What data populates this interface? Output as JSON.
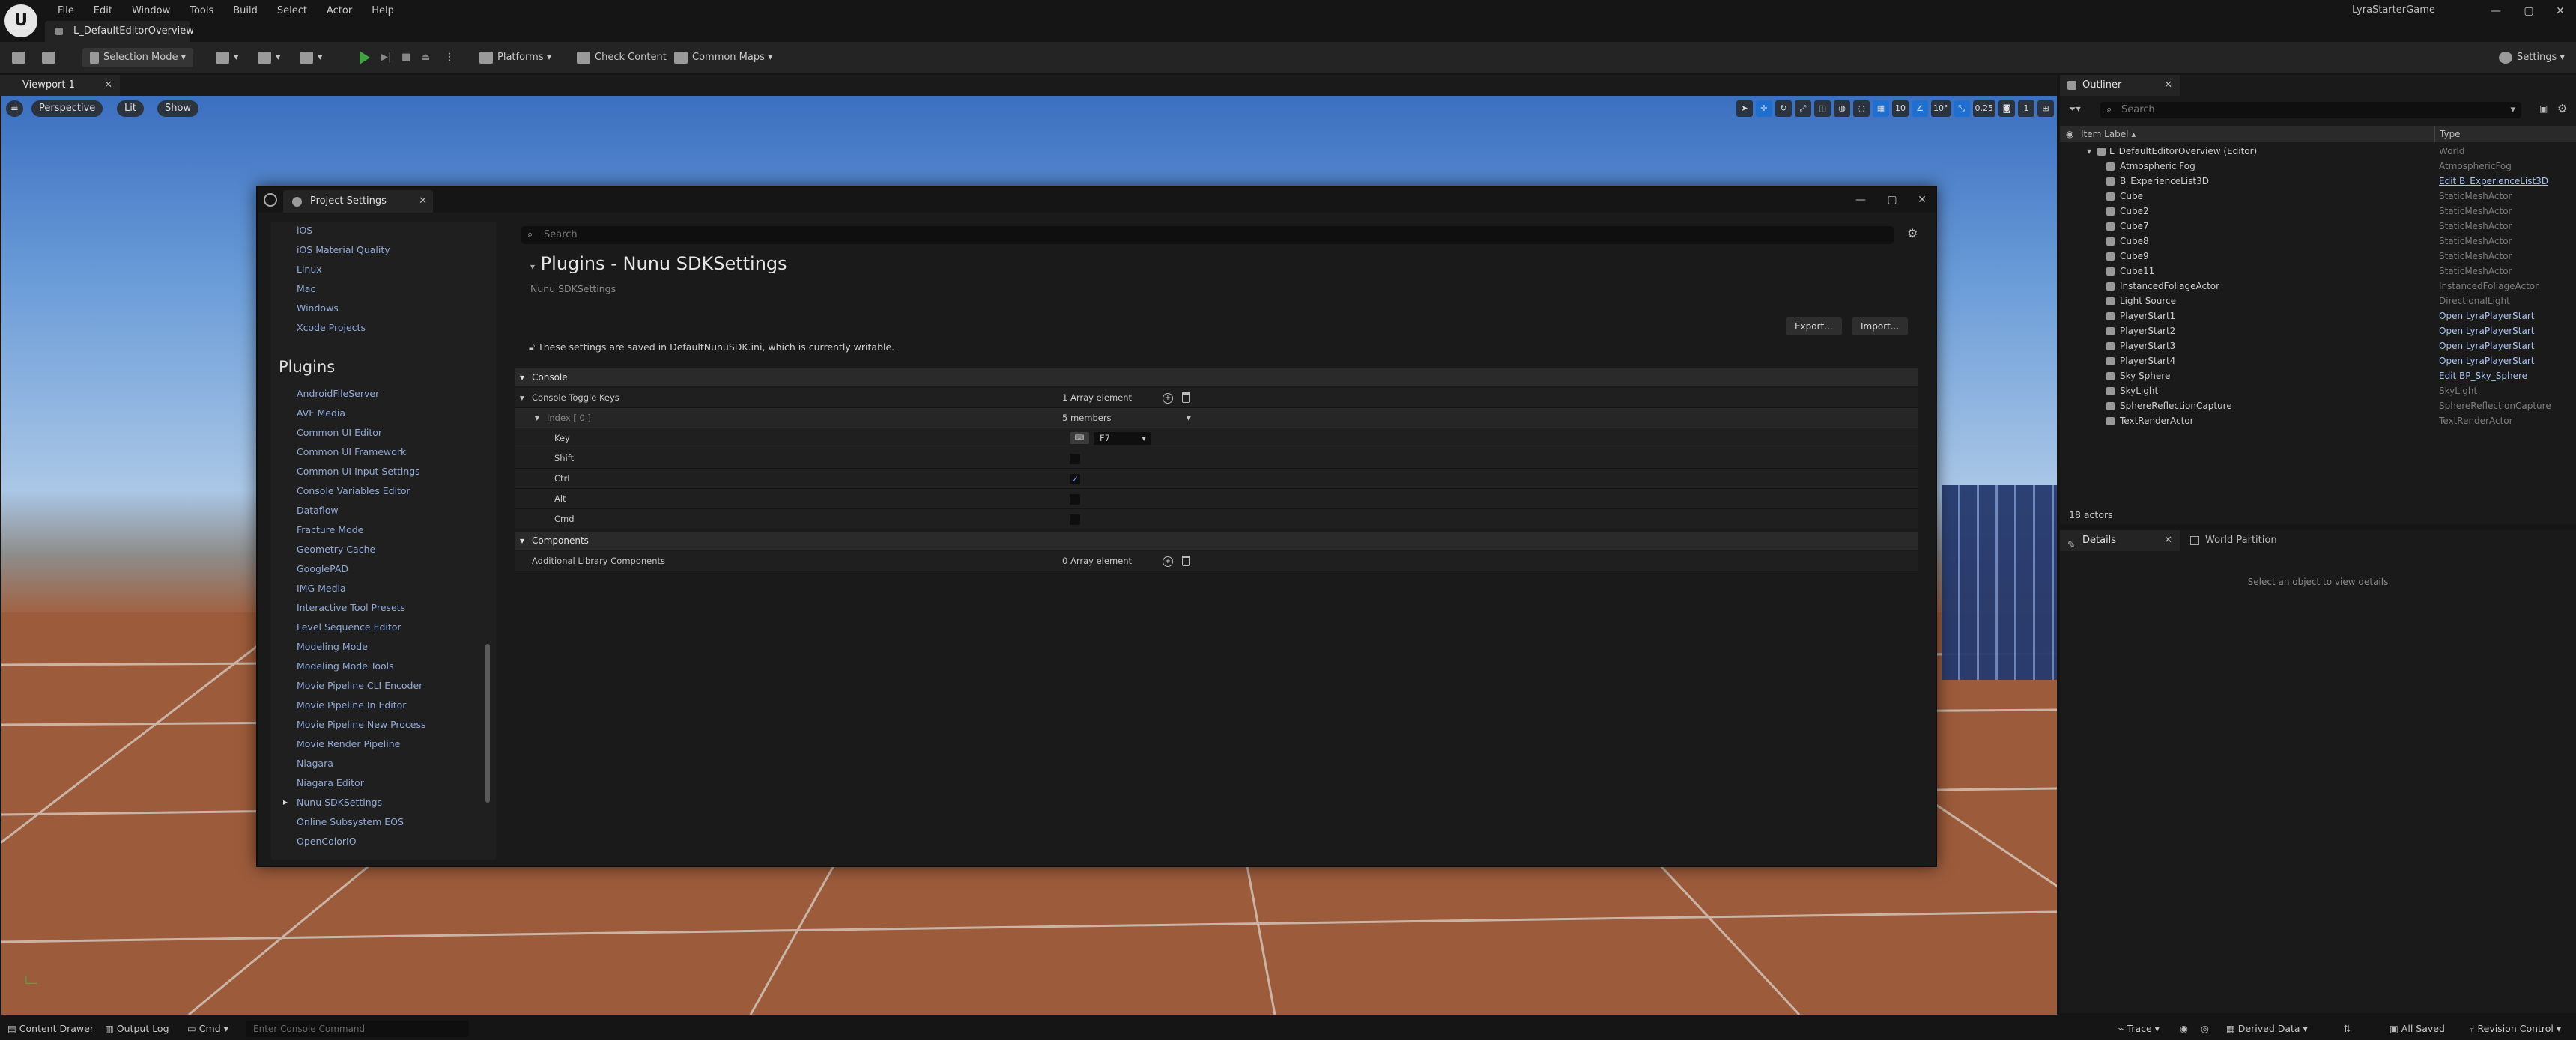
{
  "menu": [
    "File",
    "Edit",
    "Window",
    "Tools",
    "Build",
    "Select",
    "Actor",
    "Help"
  ],
  "level_tab": "L_DefaultEditorOverview",
  "project_name": "LyraStarterGame",
  "toolbar": {
    "selection_mode": "Selection Mode",
    "platforms": "Platforms",
    "check_content": "Check Content",
    "common_maps": "Common Maps",
    "settings": "Settings"
  },
  "viewport": {
    "tab": "Viewport 1",
    "perspective": "Perspective",
    "lit": "Lit",
    "show": "Show",
    "grid_snap": "10",
    "rot_snap": "10°",
    "scale_snap": "0.25",
    "camera_speed": "1"
  },
  "dialog": {
    "tab": "Project Settings",
    "nav_top": [
      "iOS",
      "iOS Material Quality",
      "Linux",
      "Mac",
      "Windows",
      "Xcode Projects"
    ],
    "plugins_header": "Plugins",
    "nav_plugins": [
      "AndroidFileServer",
      "AVF Media",
      "Common UI Editor",
      "Common UI Framework",
      "Common UI Input Settings",
      "Console Variables Editor",
      "Dataflow",
      "Fracture Mode",
      "Geometry Cache",
      "GooglePAD",
      "IMG Media",
      "Interactive Tool Presets",
      "Level Sequence Editor",
      "Modeling Mode",
      "Modeling Mode Tools",
      "Movie Pipeline CLI Encoder",
      "Movie Pipeline In Editor",
      "Movie Pipeline New Process",
      "Movie Render Pipeline",
      "Niagara",
      "Niagara Editor",
      "Nunu SDKSettings",
      "Online Subsystem EOS",
      "OpenColorIO"
    ],
    "search_placeholder": "Search",
    "page_title": "Plugins - Nunu SDKSettings",
    "page_subtitle": "Nunu SDKSettings",
    "export_label": "Export...",
    "import_label": "Import...",
    "notice": "These settings are saved in DefaultNunuSDK.ini, which is currently writable.",
    "section_console": "Console",
    "console_toggle_keys": "Console Toggle Keys",
    "console_toggle_keys_value": "1 Array element",
    "index0": "Index [ 0 ]",
    "index0_value": "5 members",
    "key_label": "Key",
    "key_value": "F7",
    "shift_label": "Shift",
    "ctrl_label": "Ctrl",
    "alt_label": "Alt",
    "cmd_label": "Cmd",
    "section_components": "Components",
    "additional_library_components": "Additional Library Components",
    "additional_library_components_value": "0 Array element"
  },
  "outliner": {
    "tab": "Outliner",
    "search_placeholder": "Search",
    "col_label": "Item Label",
    "col_type": "Type",
    "root": {
      "name": "L_DefaultEditorOverview (Editor)",
      "type": "World"
    },
    "rows": [
      {
        "name": "Atmospheric Fog",
        "type": "AtmosphericFog",
        "link": false
      },
      {
        "name": "B_ExperienceList3D",
        "type": "Edit B_ExperienceList3D",
        "link": true
      },
      {
        "name": "Cube",
        "type": "StaticMeshActor",
        "link": false
      },
      {
        "name": "Cube2",
        "type": "StaticMeshActor",
        "link": false
      },
      {
        "name": "Cube7",
        "type": "StaticMeshActor",
        "link": false
      },
      {
        "name": "Cube8",
        "type": "StaticMeshActor",
        "link": false
      },
      {
        "name": "Cube9",
        "type": "StaticMeshActor",
        "link": false
      },
      {
        "name": "Cube11",
        "type": "StaticMeshActor",
        "link": false
      },
      {
        "name": "InstancedFoliageActor",
        "type": "InstancedFoliageActor",
        "link": false
      },
      {
        "name": "Light Source",
        "type": "DirectionalLight",
        "link": false
      },
      {
        "name": "PlayerStart1",
        "type": "Open LyraPlayerStart",
        "link": true
      },
      {
        "name": "PlayerStart2",
        "type": "Open LyraPlayerStart",
        "link": true
      },
      {
        "name": "PlayerStart3",
        "type": "Open LyraPlayerStart",
        "link": true
      },
      {
        "name": "PlayerStart4",
        "type": "Open LyraPlayerStart",
        "link": true
      },
      {
        "name": "Sky Sphere",
        "type": "Edit BP_Sky_Sphere",
        "link": true
      },
      {
        "name": "SkyLight",
        "type": "SkyLight",
        "link": false
      },
      {
        "name": "SphereReflectionCapture",
        "type": "SphereReflectionCapture",
        "link": false
      },
      {
        "name": "TextRenderActor",
        "type": "TextRenderActor",
        "link": false
      }
    ],
    "actor_count": "18 actors"
  },
  "details": {
    "tab": "Details",
    "world_partition_tab": "World Partition",
    "empty": "Select an object to view details"
  },
  "statusbar": {
    "content_drawer": "Content Drawer",
    "output_log": "Output Log",
    "cmd": "Cmd",
    "console_placeholder": "Enter Console Command",
    "trace": "Trace",
    "derived_data": "Derived Data",
    "all_saved": "All Saved",
    "revision_control": "Revision Control"
  }
}
